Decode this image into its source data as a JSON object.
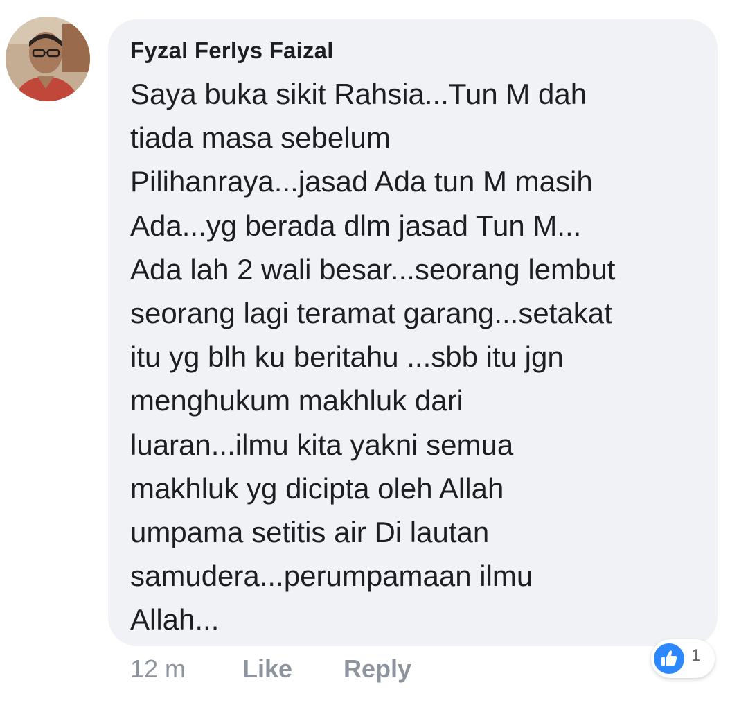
{
  "comment": {
    "author": "Fyzal Ferlys Faizal",
    "lines": [
      "Saya buka sikit Rahsia...Tun M dah",
      "tiada masa sebelum",
      "Pilihanraya...jasad Ada tun M masih",
      "Ada...yg berada dlm jasad Tun M...",
      "Ada lah 2 wali besar...seorang lembut",
      "seorang lagi teramat garang...setakat",
      "itu yg blh ku beritahu ...sbb itu jgn",
      "menghukum makhluk dari",
      "luaran...ilmu kita yakni semua",
      "makhluk yg dicipta oleh Allah",
      "umpama setitis air Di lautan",
      "samudera...perumpamaan ilmu",
      "Allah..."
    ],
    "timestamp": "12 m",
    "like_label": "Like",
    "reply_label": "Reply",
    "reaction_count": "1",
    "reaction_icon": "thumbs-up-icon"
  },
  "colors": {
    "bubble": "#f0f2f5",
    "text": "#1c1e21",
    "meta": "#8d949e",
    "like_blue": "#2d88ff"
  }
}
